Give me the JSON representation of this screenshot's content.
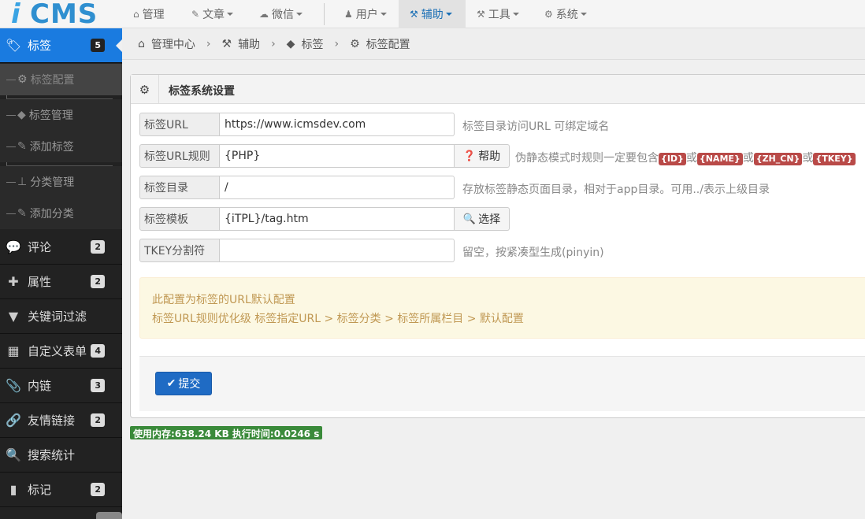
{
  "brand": {
    "logo_i": "i",
    "logo_cms": "CMS"
  },
  "topnav": [
    {
      "label": "管理",
      "icon": "home-icon"
    },
    {
      "label": "文章",
      "icon": "edit-icon"
    },
    {
      "label": "微信",
      "icon": "wechat-icon"
    },
    {
      "label": "用户",
      "icon": "user-icon"
    },
    {
      "label": "辅助",
      "icon": "gavel-icon"
    },
    {
      "label": "工具",
      "icon": "gavel-icon"
    },
    {
      "label": "系统",
      "icon": "cog-icon"
    }
  ],
  "sidebar": {
    "main": [
      {
        "label": "标签",
        "badge": "5"
      },
      {
        "label": "评论",
        "badge": "2"
      },
      {
        "label": "属性",
        "badge": "2"
      },
      {
        "label": "关键词过滤",
        "badge": ""
      },
      {
        "label": "自定义表单",
        "badge": "4"
      },
      {
        "label": "内链",
        "badge": "3"
      },
      {
        "label": "友情链接",
        "badge": "2"
      },
      {
        "label": "搜索统计",
        "badge": ""
      },
      {
        "label": "标记",
        "badge": "2"
      }
    ],
    "sub": [
      {
        "label": "标签配置"
      },
      {
        "label": "标签管理"
      },
      {
        "label": "添加标签"
      },
      {
        "label": "分类管理"
      },
      {
        "label": "添加分类"
      }
    ]
  },
  "breadcrumb": [
    "管理中心",
    "辅助",
    "标签",
    "标签配置"
  ],
  "panel": {
    "title": "标签系统设置",
    "fields": [
      {
        "label": "标签URL",
        "value": "https://www.icmsdev.com",
        "help": "标签目录访问URL 可绑定域名"
      },
      {
        "label": "标签URL规则",
        "value": "{PHP}",
        "button": "帮助",
        "help_prefix": "伪静态模式时规则一定要包含",
        "tags": [
          "{ID}",
          "{NAME}",
          "{ZH_CN}",
          "{TKEY}"
        ],
        "or": "或"
      },
      {
        "label": "标签目录",
        "value": "/",
        "help": "存放标签静态页面目录，相对于app目录。可用../表示上级目录"
      },
      {
        "label": "标签模板",
        "value": "{iTPL}/tag.htm",
        "button": "选择"
      },
      {
        "label": "TKEY分割符",
        "value": "",
        "help": "留空，按紧凑型生成(pinyin)"
      }
    ],
    "alert_line1": "此配置为标签的URL默认配置",
    "alert_line2": "标签URL规则优化级 标签指定URL > 标签分类 > 标签所属栏目 > 默认配置",
    "submit": "提交"
  },
  "stats": "使用内存:638.24 KB 执行时间:0.0246 s"
}
